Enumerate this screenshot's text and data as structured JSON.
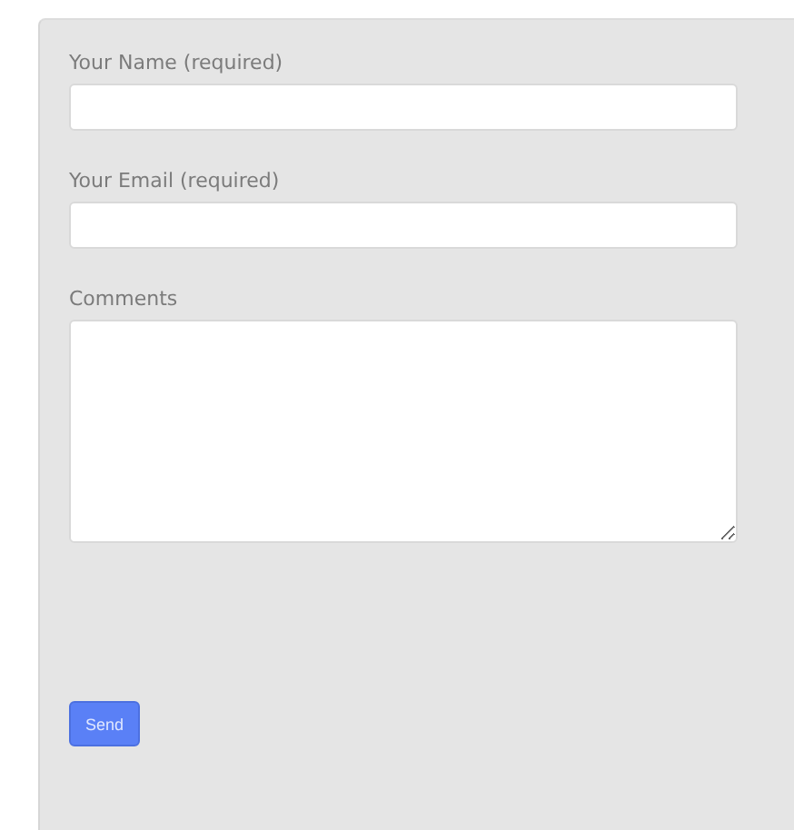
{
  "form": {
    "fields": [
      {
        "kind": "text",
        "label": "Your Name (required)"
      },
      {
        "kind": "text",
        "label": "Your Email (required)"
      },
      {
        "kind": "textarea",
        "label": "Comments"
      }
    ],
    "submit": {
      "label": "Send"
    }
  }
}
